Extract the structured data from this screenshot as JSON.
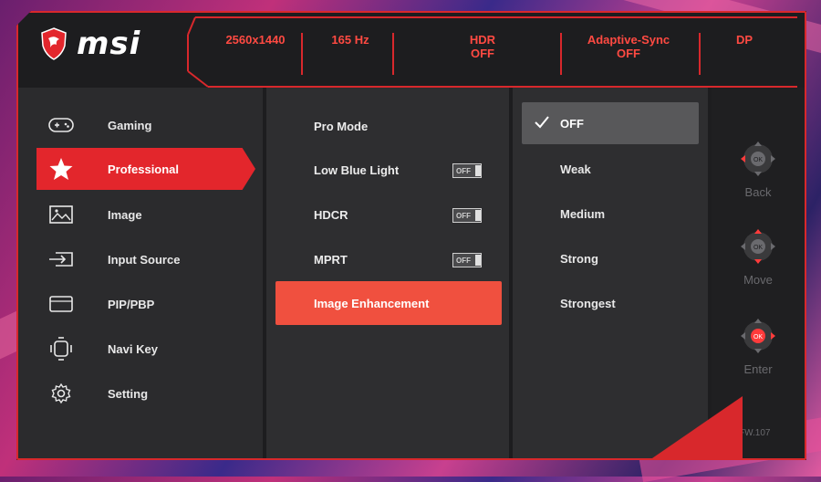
{
  "brand": {
    "name": "msi"
  },
  "header": {
    "resolution": "2560x1440",
    "refresh_rate": "165 Hz",
    "hdr": {
      "label": "HDR",
      "value": "OFF"
    },
    "adaptive_sync": {
      "label": "Adaptive-Sync",
      "value": "OFF"
    },
    "input": "DP"
  },
  "menu": {
    "items": [
      {
        "label": "Gaming",
        "icon": "gamepad-icon",
        "active": false
      },
      {
        "label": "Professional",
        "icon": "star-icon",
        "active": true
      },
      {
        "label": "Image",
        "icon": "image-icon",
        "active": false
      },
      {
        "label": "Input Source",
        "icon": "input-source-icon",
        "active": false
      },
      {
        "label": "PIP/PBP",
        "icon": "pip-pbp-icon",
        "active": false
      },
      {
        "label": "Navi Key",
        "icon": "navi-key-icon",
        "active": false
      },
      {
        "label": "Setting",
        "icon": "gear-icon",
        "active": false
      }
    ]
  },
  "submenu": {
    "items": [
      {
        "label": "Pro Mode",
        "toggle": null,
        "active": false
      },
      {
        "label": "Low Blue Light",
        "toggle": "OFF",
        "active": false
      },
      {
        "label": "HDCR",
        "toggle": "OFF",
        "active": false
      },
      {
        "label": "MPRT",
        "toggle": "OFF",
        "active": false
      },
      {
        "label": "Image Enhancement",
        "toggle": null,
        "active": true
      }
    ]
  },
  "options": {
    "items": [
      {
        "label": "OFF",
        "selected": true
      },
      {
        "label": "Weak",
        "selected": false
      },
      {
        "label": "Medium",
        "selected": false
      },
      {
        "label": "Strong",
        "selected": false
      },
      {
        "label": "Strongest",
        "selected": false
      }
    ]
  },
  "nav": {
    "back": "Back",
    "move": "Move",
    "enter": "Enter",
    "ok": "OK",
    "firmware": "FW.107"
  },
  "colors": {
    "accent": "#e3262c",
    "accent_light": "#f0503f",
    "header_text": "#ff4a42",
    "panel": "#2e2e30"
  }
}
